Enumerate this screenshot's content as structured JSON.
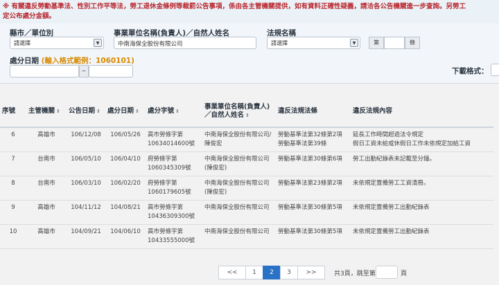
{
  "notice": {
    "line1": "※ 有關違反勞動基準法、性別工作平等法，勞工退休金條例等裁罰公告事項，係由各主管機關提供，如有資料正確性疑義，請洽各公告機關進一步查詢。另勞工",
    "line2": "定公布處分金額。"
  },
  "search": {
    "city_label": "縣市／單位別",
    "city_value": "請選擇",
    "company_label": "事業單位名稱(負責人)／自然人姓名",
    "company_value": "中南海保全股份有限公司",
    "law_label": "法規名稱",
    "law_value": "請選擇",
    "page_prefix": "第",
    "page_suffix": "條",
    "date_label": "處分日期",
    "date_hint": "(輸入格式範例：1060101)",
    "date_sep": "~",
    "download_label": "下載格式："
  },
  "table": {
    "headers": {
      "seq": "序號",
      "authority": "主管機關",
      "announce_date": "公告日期",
      "penalty_date": "處分日期",
      "doc_no": "處分字號",
      "company": "事業單位名稱(負責人)／自然人姓名",
      "law": "違反法規法條",
      "content": "違反法規內容"
    },
    "rows": [
      {
        "seq": "6",
        "authority": "高雄市",
        "announce": "106/12/08",
        "penalty": "106/05/26",
        "doc": "高市勞條字第10634014600號",
        "company": "中南海保全股份有限公司/陳俊宏",
        "law": "勞動基準法第32條第2項\n勞動基準法第39條",
        "content": "延長工作時間超過法令規定\n假日工資未給或休假日工作未依規定加給工資"
      },
      {
        "seq": "7",
        "authority": "台南市",
        "announce": "106/05/10",
        "penalty": "106/04/10",
        "doc": "府勞條字第1060345309號",
        "company": "中南海保全股份有限公司(陳俊宏)",
        "law": "勞動基準法第30條第6項",
        "content": "勞工出勤紀錄表未記載至分鐘。"
      },
      {
        "seq": "8",
        "authority": "台南市",
        "announce": "106/03/10",
        "penalty": "106/02/20",
        "doc": "府勞條字第1060179605號",
        "company": "中南海保全股份有限公司(陳俊宏)",
        "law": "勞動基準法第23條第2項",
        "content": "未依規定置備勞工工資清冊。"
      },
      {
        "seq": "9",
        "authority": "高雄市",
        "announce": "104/11/12",
        "penalty": "104/08/21",
        "doc": "高市勞條字第10436309300號",
        "company": "中南海保全股份有限公司",
        "law": "勞動基準法第30條第5項",
        "content": "未依規定置備勞工出勤紀錄表"
      },
      {
        "seq": "10",
        "authority": "高雄市",
        "announce": "104/09/21",
        "penalty": "104/06/10",
        "doc": "高市勞條字第10433555000號",
        "company": "中南海保全股份有限公司",
        "law": "勞動基準法第30條第5項",
        "content": "未依規定置備勞工出勤紀錄表"
      }
    ]
  },
  "pagination": {
    "prev": "<<",
    "pages": [
      "1",
      "2",
      "3"
    ],
    "active": "2",
    "next": ">>",
    "info": "共3頁，跳至第",
    "suffix": "頁"
  }
}
